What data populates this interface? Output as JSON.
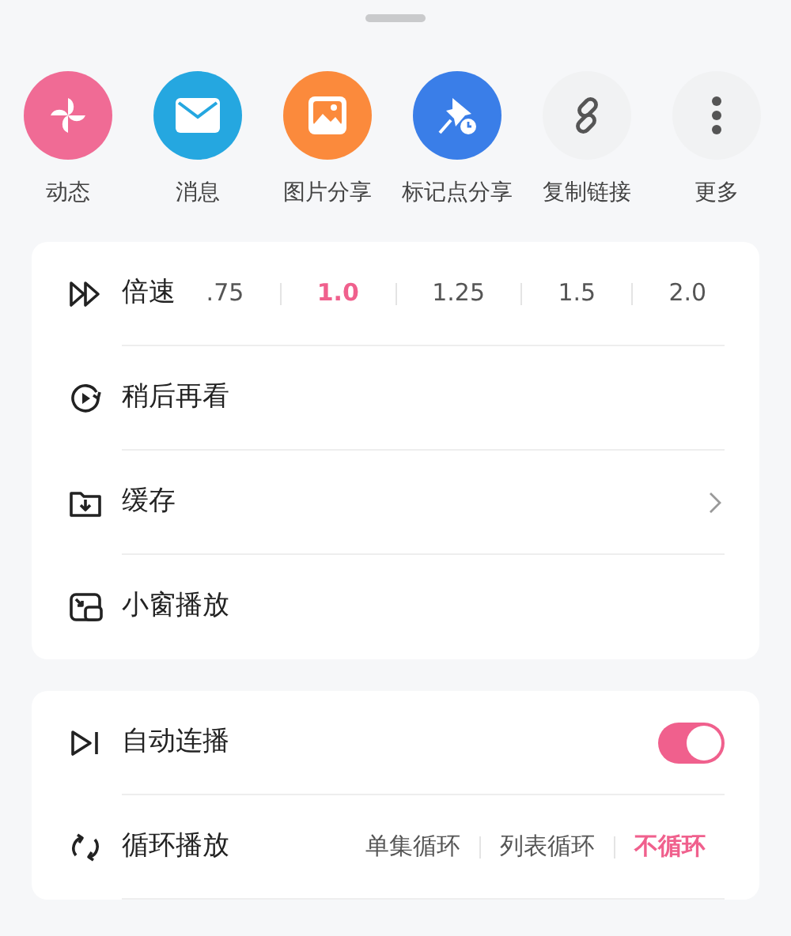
{
  "share_items": [
    {
      "label": "动态",
      "color": "#f06b95"
    },
    {
      "label": "消息",
      "color": "#25a7e0"
    },
    {
      "label": "图片分享",
      "color": "#fb8a3c"
    },
    {
      "label": "标记点分享",
      "color": "#3a7ee8"
    },
    {
      "label": "复制链接",
      "color": "#f1f2f3"
    },
    {
      "label": "更多",
      "color": "#f1f2f3"
    }
  ],
  "sections": [
    {
      "rows": [
        {
          "kind": "options",
          "label": "倍速",
          "options": [
            {
              "label": ".75",
              "selected": false
            },
            {
              "label": "1.0",
              "selected": true
            },
            {
              "label": "1.25",
              "selected": false
            },
            {
              "label": "1.5",
              "selected": false
            },
            {
              "label": "2.0",
              "selected": false
            }
          ]
        },
        {
          "kind": "plain",
          "label": "稍后再看"
        },
        {
          "kind": "link",
          "label": "缓存"
        },
        {
          "kind": "plain",
          "label": "小窗播放"
        }
      ]
    },
    {
      "rows": [
        {
          "kind": "toggle",
          "label": "自动连播",
          "on": true
        },
        {
          "kind": "options",
          "label": "循环播放",
          "options": [
            {
              "label": "单集循环",
              "selected": false
            },
            {
              "label": "列表循环",
              "selected": false
            },
            {
              "label": "不循环",
              "selected": true
            }
          ]
        }
      ]
    }
  ]
}
